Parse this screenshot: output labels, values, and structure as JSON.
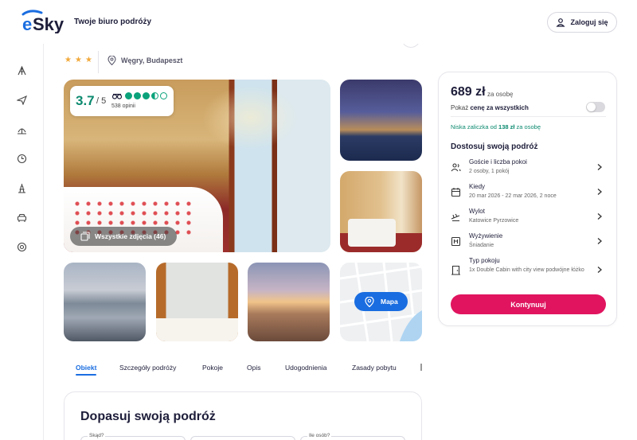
{
  "header": {
    "logo_text": "eSky",
    "tagline": "Twoje biuro podróży",
    "login_label": "Zaloguj się"
  },
  "sidebar": {
    "items": [
      {
        "icon": "hotel-icon"
      },
      {
        "icon": "plane-icon"
      },
      {
        "icon": "beach-vacation-icon"
      },
      {
        "icon": "last-minute-clock-icon"
      },
      {
        "icon": "city-break-icon"
      },
      {
        "icon": "car-icon"
      },
      {
        "icon": "support-icon"
      }
    ]
  },
  "hotel": {
    "stars": 3,
    "location": "Węgry, Budapeszt"
  },
  "gallery": {
    "rating_score": "3.7",
    "rating_max": "/ 5",
    "rating_dots": 3.5,
    "reviews": "538 opinii",
    "all_photos_label": "Wszystkie zdjęcia (46)",
    "map_label": "Mapa"
  },
  "tabs": [
    {
      "label": "Obiekt",
      "active": true
    },
    {
      "label": "Szczegóły podróży"
    },
    {
      "label": "Pokoje"
    },
    {
      "label": "Opis"
    },
    {
      "label": "Udogodnienia"
    },
    {
      "label": "Zasady pobytu"
    }
  ],
  "bottom": {
    "title": "Dopasuj swoją podróż",
    "field_from_label": "Skąd?",
    "field_count_label": "Ile osób?"
  },
  "booking": {
    "price": "689 zł",
    "price_unit": "za osobę",
    "show_total_prefix": "Pokaż ",
    "show_total_bold": "cenę za wszystkich",
    "deposit_prefix": "Niska zaliczka od ",
    "deposit_amount": "138 zł",
    "deposit_suffix": " za osobę",
    "customize_title": "Dostosuj swoją podróż",
    "options": [
      {
        "title": "Goście i liczba pokoi",
        "sub": "2 osoby, 1 pokój",
        "icon": "guests-icon"
      },
      {
        "title": "Kiedy",
        "sub": "20 mar 2026 - 22 mar 2026, 2 noce",
        "icon": "calendar-icon"
      },
      {
        "title": "Wylot",
        "sub": "Katowice Pyrzowice",
        "icon": "departure-icon"
      },
      {
        "title": "Wyżywienie",
        "sub": "Śniadanie",
        "icon": "meal-icon"
      },
      {
        "title": "Typ pokoju",
        "sub": "1x Double Cabin with city view podwójne łóżko",
        "icon": "door-icon"
      }
    ],
    "cta_label": "Kontynuuj"
  },
  "colors": {
    "brand_blue": "#1a6de0",
    "cta_pink": "#e0145f",
    "rating_green": "#0c8a6f",
    "star_orange": "#f2a93b"
  }
}
